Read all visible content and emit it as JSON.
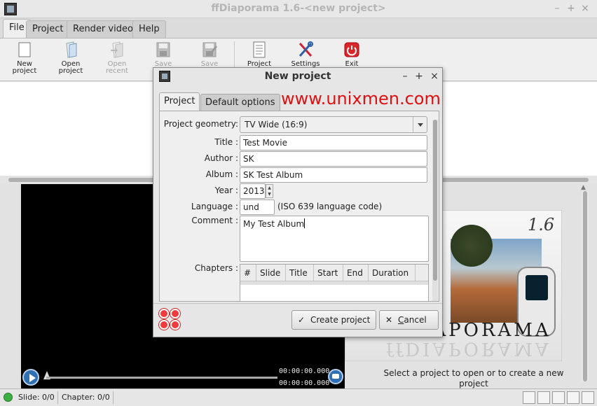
{
  "window": {
    "title": "ffDiaporama 1.6-<new project>",
    "min_glyph": "–",
    "max_glyph": "+",
    "close_glyph": "×"
  },
  "menu_tabs": [
    "File",
    "Project",
    "Render video",
    "Help"
  ],
  "toolbar": {
    "items": [
      {
        "label_line1": "New",
        "label_line2": "project",
        "enabled": true
      },
      {
        "label_line1": "Open",
        "label_line2": "project",
        "enabled": true
      },
      {
        "label_line1": "Open",
        "label_line2": "recent",
        "enabled": false
      },
      {
        "label_line1": "Save",
        "label_line2": "",
        "enabled": false
      },
      {
        "label_line1": "Save",
        "label_line2": "",
        "enabled": false
      },
      {
        "label_line1": "Project",
        "label_line2": "",
        "enabled": true
      },
      {
        "label_line1": "Settings",
        "label_line2": "",
        "enabled": true
      },
      {
        "label_line1": "Exit",
        "label_line2": "",
        "enabled": true
      }
    ]
  },
  "player": {
    "timecode_current": "00:00:00.000",
    "timecode_total": "00:00:00.000"
  },
  "splash": {
    "version": "1.6",
    "brand": "ffDIAPORAMA",
    "hint": "Select a project to open or to create a new project"
  },
  "statusbar": {
    "slide": "Slide: 0/0",
    "chapter": "Chapter: 0/0"
  },
  "dialog": {
    "title": "New project",
    "tabs": [
      "Project",
      "Default options"
    ],
    "watermark": "www.unixmen.com",
    "fields": {
      "geometry_label": "Project geometry:",
      "geometry_value": "TV Wide (16:9)",
      "title_label": "Title :",
      "title_value": "Test Movie",
      "author_label": "Author :",
      "author_value": "SK",
      "album_label": "Album :",
      "album_value": "SK Test Album",
      "year_label": "Year :",
      "year_value": "2013",
      "language_label": "Language :",
      "language_value": "und",
      "language_hint": "(ISO 639 language code)",
      "comment_label": "Comment :",
      "comment_value": "My Test Album",
      "chapters_label": "Chapters :"
    },
    "chapter_columns": [
      "#",
      "Slide",
      "Title",
      "Start",
      "End",
      "Duration"
    ],
    "buttons": {
      "create": "Create project",
      "cancel_prefix": "",
      "cancel_mnemonic": "C",
      "cancel_rest": "ancel"
    }
  }
}
